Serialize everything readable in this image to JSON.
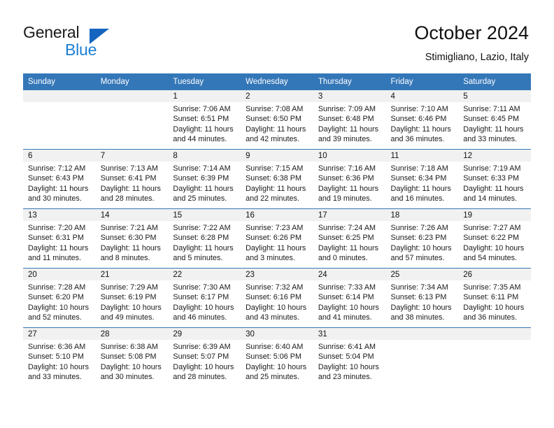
{
  "brand": {
    "name_top": "General",
    "name_bottom": "Blue",
    "accent_color": "#1a7fd4",
    "triangle_color": "#1565c0"
  },
  "header": {
    "title": "October 2024",
    "subtitle": "Stimigliano, Lazio, Italy"
  },
  "calendar": {
    "header_bg": "#3477b8",
    "daynum_bg": "#f1f1f1",
    "weekdays": [
      "Sunday",
      "Monday",
      "Tuesday",
      "Wednesday",
      "Thursday",
      "Friday",
      "Saturday"
    ],
    "weeks": [
      [
        {
          "day": "",
          "sunrise": "",
          "sunset": "",
          "daylight_line1": "",
          "daylight_line2": ""
        },
        {
          "day": "",
          "sunrise": "",
          "sunset": "",
          "daylight_line1": "",
          "daylight_line2": ""
        },
        {
          "day": "1",
          "sunrise": "Sunrise: 7:06 AM",
          "sunset": "Sunset: 6:51 PM",
          "daylight_line1": "Daylight: 11 hours",
          "daylight_line2": "and 44 minutes."
        },
        {
          "day": "2",
          "sunrise": "Sunrise: 7:08 AM",
          "sunset": "Sunset: 6:50 PM",
          "daylight_line1": "Daylight: 11 hours",
          "daylight_line2": "and 42 minutes."
        },
        {
          "day": "3",
          "sunrise": "Sunrise: 7:09 AM",
          "sunset": "Sunset: 6:48 PM",
          "daylight_line1": "Daylight: 11 hours",
          "daylight_line2": "and 39 minutes."
        },
        {
          "day": "4",
          "sunrise": "Sunrise: 7:10 AM",
          "sunset": "Sunset: 6:46 PM",
          "daylight_line1": "Daylight: 11 hours",
          "daylight_line2": "and 36 minutes."
        },
        {
          "day": "5",
          "sunrise": "Sunrise: 7:11 AM",
          "sunset": "Sunset: 6:45 PM",
          "daylight_line1": "Daylight: 11 hours",
          "daylight_line2": "and 33 minutes."
        }
      ],
      [
        {
          "day": "6",
          "sunrise": "Sunrise: 7:12 AM",
          "sunset": "Sunset: 6:43 PM",
          "daylight_line1": "Daylight: 11 hours",
          "daylight_line2": "and 30 minutes."
        },
        {
          "day": "7",
          "sunrise": "Sunrise: 7:13 AM",
          "sunset": "Sunset: 6:41 PM",
          "daylight_line1": "Daylight: 11 hours",
          "daylight_line2": "and 28 minutes."
        },
        {
          "day": "8",
          "sunrise": "Sunrise: 7:14 AM",
          "sunset": "Sunset: 6:39 PM",
          "daylight_line1": "Daylight: 11 hours",
          "daylight_line2": "and 25 minutes."
        },
        {
          "day": "9",
          "sunrise": "Sunrise: 7:15 AM",
          "sunset": "Sunset: 6:38 PM",
          "daylight_line1": "Daylight: 11 hours",
          "daylight_line2": "and 22 minutes."
        },
        {
          "day": "10",
          "sunrise": "Sunrise: 7:16 AM",
          "sunset": "Sunset: 6:36 PM",
          "daylight_line1": "Daylight: 11 hours",
          "daylight_line2": "and 19 minutes."
        },
        {
          "day": "11",
          "sunrise": "Sunrise: 7:18 AM",
          "sunset": "Sunset: 6:34 PM",
          "daylight_line1": "Daylight: 11 hours",
          "daylight_line2": "and 16 minutes."
        },
        {
          "day": "12",
          "sunrise": "Sunrise: 7:19 AM",
          "sunset": "Sunset: 6:33 PM",
          "daylight_line1": "Daylight: 11 hours",
          "daylight_line2": "and 14 minutes."
        }
      ],
      [
        {
          "day": "13",
          "sunrise": "Sunrise: 7:20 AM",
          "sunset": "Sunset: 6:31 PM",
          "daylight_line1": "Daylight: 11 hours",
          "daylight_line2": "and 11 minutes."
        },
        {
          "day": "14",
          "sunrise": "Sunrise: 7:21 AM",
          "sunset": "Sunset: 6:30 PM",
          "daylight_line1": "Daylight: 11 hours",
          "daylight_line2": "and 8 minutes."
        },
        {
          "day": "15",
          "sunrise": "Sunrise: 7:22 AM",
          "sunset": "Sunset: 6:28 PM",
          "daylight_line1": "Daylight: 11 hours",
          "daylight_line2": "and 5 minutes."
        },
        {
          "day": "16",
          "sunrise": "Sunrise: 7:23 AM",
          "sunset": "Sunset: 6:26 PM",
          "daylight_line1": "Daylight: 11 hours",
          "daylight_line2": "and 3 minutes."
        },
        {
          "day": "17",
          "sunrise": "Sunrise: 7:24 AM",
          "sunset": "Sunset: 6:25 PM",
          "daylight_line1": "Daylight: 11 hours",
          "daylight_line2": "and 0 minutes."
        },
        {
          "day": "18",
          "sunrise": "Sunrise: 7:26 AM",
          "sunset": "Sunset: 6:23 PM",
          "daylight_line1": "Daylight: 10 hours",
          "daylight_line2": "and 57 minutes."
        },
        {
          "day": "19",
          "sunrise": "Sunrise: 7:27 AM",
          "sunset": "Sunset: 6:22 PM",
          "daylight_line1": "Daylight: 10 hours",
          "daylight_line2": "and 54 minutes."
        }
      ],
      [
        {
          "day": "20",
          "sunrise": "Sunrise: 7:28 AM",
          "sunset": "Sunset: 6:20 PM",
          "daylight_line1": "Daylight: 10 hours",
          "daylight_line2": "and 52 minutes."
        },
        {
          "day": "21",
          "sunrise": "Sunrise: 7:29 AM",
          "sunset": "Sunset: 6:19 PM",
          "daylight_line1": "Daylight: 10 hours",
          "daylight_line2": "and 49 minutes."
        },
        {
          "day": "22",
          "sunrise": "Sunrise: 7:30 AM",
          "sunset": "Sunset: 6:17 PM",
          "daylight_line1": "Daylight: 10 hours",
          "daylight_line2": "and 46 minutes."
        },
        {
          "day": "23",
          "sunrise": "Sunrise: 7:32 AM",
          "sunset": "Sunset: 6:16 PM",
          "daylight_line1": "Daylight: 10 hours",
          "daylight_line2": "and 43 minutes."
        },
        {
          "day": "24",
          "sunrise": "Sunrise: 7:33 AM",
          "sunset": "Sunset: 6:14 PM",
          "daylight_line1": "Daylight: 10 hours",
          "daylight_line2": "and 41 minutes."
        },
        {
          "day": "25",
          "sunrise": "Sunrise: 7:34 AM",
          "sunset": "Sunset: 6:13 PM",
          "daylight_line1": "Daylight: 10 hours",
          "daylight_line2": "and 38 minutes."
        },
        {
          "day": "26",
          "sunrise": "Sunrise: 7:35 AM",
          "sunset": "Sunset: 6:11 PM",
          "daylight_line1": "Daylight: 10 hours",
          "daylight_line2": "and 36 minutes."
        }
      ],
      [
        {
          "day": "27",
          "sunrise": "Sunrise: 6:36 AM",
          "sunset": "Sunset: 5:10 PM",
          "daylight_line1": "Daylight: 10 hours",
          "daylight_line2": "and 33 minutes."
        },
        {
          "day": "28",
          "sunrise": "Sunrise: 6:38 AM",
          "sunset": "Sunset: 5:08 PM",
          "daylight_line1": "Daylight: 10 hours",
          "daylight_line2": "and 30 minutes."
        },
        {
          "day": "29",
          "sunrise": "Sunrise: 6:39 AM",
          "sunset": "Sunset: 5:07 PM",
          "daylight_line1": "Daylight: 10 hours",
          "daylight_line2": "and 28 minutes."
        },
        {
          "day": "30",
          "sunrise": "Sunrise: 6:40 AM",
          "sunset": "Sunset: 5:06 PM",
          "daylight_line1": "Daylight: 10 hours",
          "daylight_line2": "and 25 minutes."
        },
        {
          "day": "31",
          "sunrise": "Sunrise: 6:41 AM",
          "sunset": "Sunset: 5:04 PM",
          "daylight_line1": "Daylight: 10 hours",
          "daylight_line2": "and 23 minutes."
        },
        {
          "day": "",
          "sunrise": "",
          "sunset": "",
          "daylight_line1": "",
          "daylight_line2": ""
        },
        {
          "day": "",
          "sunrise": "",
          "sunset": "",
          "daylight_line1": "",
          "daylight_line2": ""
        }
      ]
    ]
  }
}
